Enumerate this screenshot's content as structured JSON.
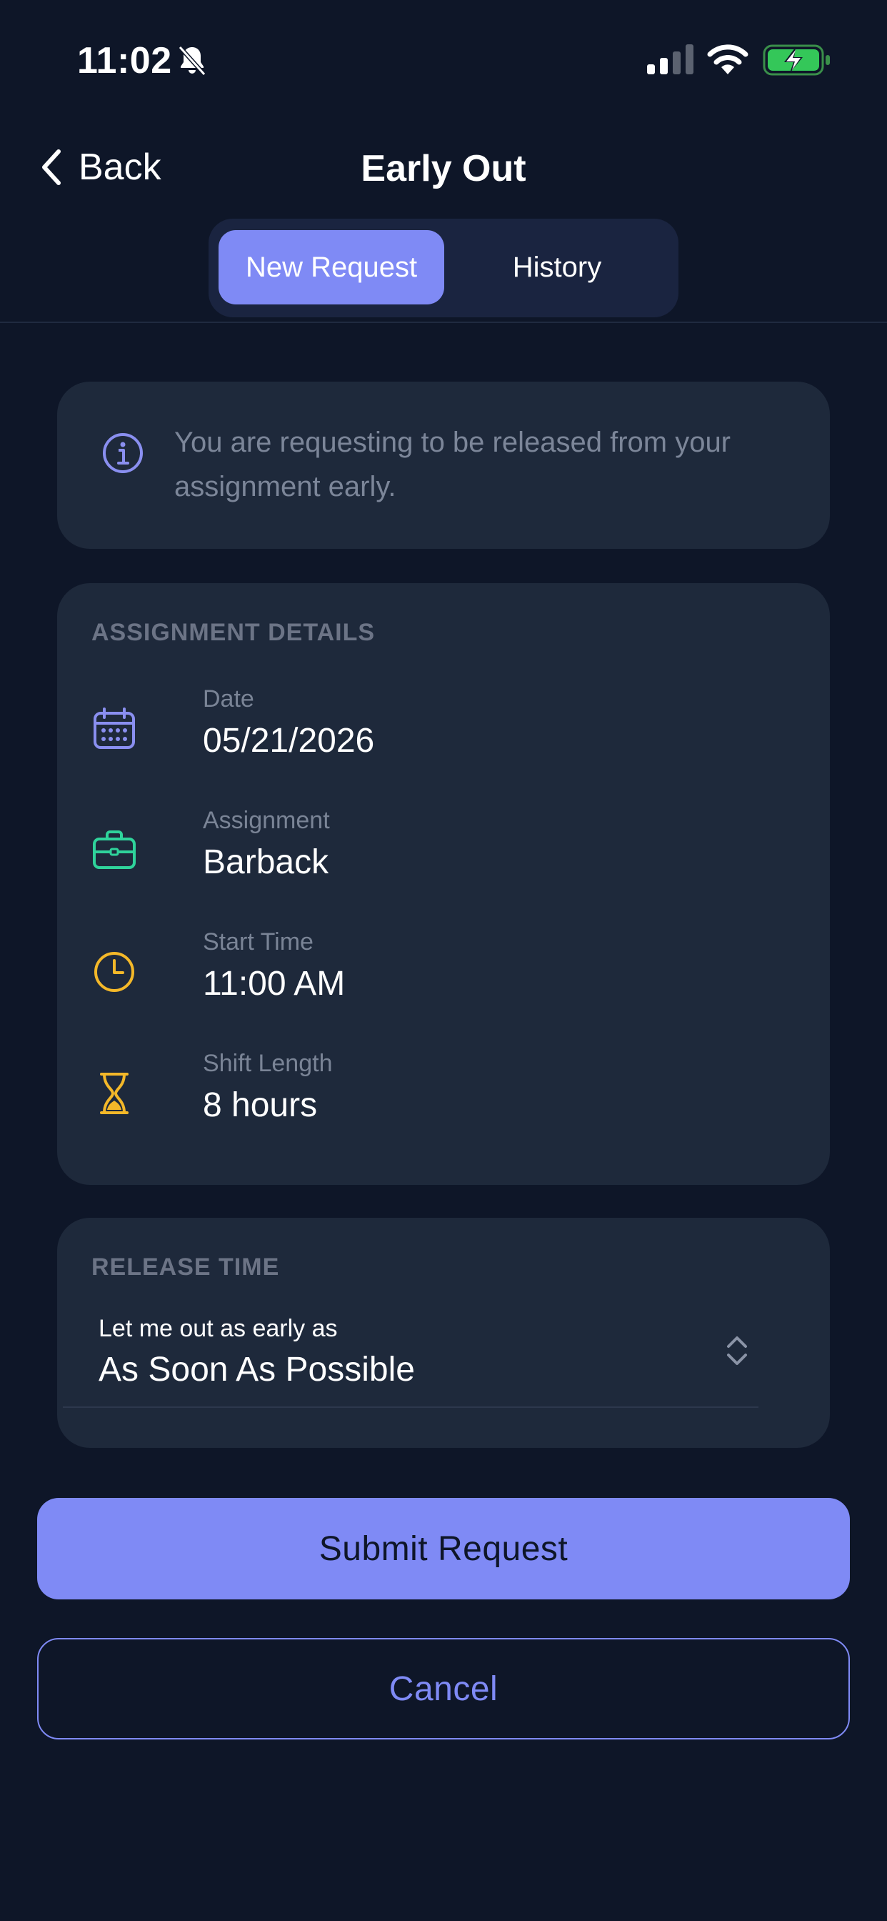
{
  "status_bar": {
    "time": "11:02",
    "icons": [
      "bell-slash-icon",
      "signal-icon",
      "wifi-icon",
      "battery-charging-icon"
    ]
  },
  "nav": {
    "back_label": "Back",
    "title": "Early Out"
  },
  "segments": {
    "new_request": "New Request",
    "history": "History",
    "selected": "New Request"
  },
  "info": {
    "text": "You are requesting to be released from your assignment early.",
    "icon": "info-icon"
  },
  "assignment_details": {
    "title": "ASSIGNMENT DETAILS",
    "rows": [
      {
        "label": "Date",
        "value": "05/21/2026",
        "icon": "calendar-icon"
      },
      {
        "label": "Assignment",
        "value": "Barback",
        "icon": "briefcase-icon"
      },
      {
        "label": "Start Time",
        "value": "11:00 AM",
        "icon": "clock-icon"
      },
      {
        "label": "Shift Length",
        "value": "8 hours",
        "icon": "hourglass-icon"
      }
    ]
  },
  "release_time": {
    "title": "RELEASE TIME",
    "label": "Let me out as early as",
    "value": "As Soon As Possible"
  },
  "actions": {
    "submit_label": "Submit Request",
    "cancel_label": "Cancel"
  },
  "colors": {
    "background": "#0e1628",
    "card": "#1e293b",
    "accent": "#7f8af5",
    "calendar_icon": "#8a8ff0",
    "briefcase_icon": "#2fd39b",
    "clock_icon": "#f4b829",
    "hourglass_icon": "#f4b829"
  }
}
